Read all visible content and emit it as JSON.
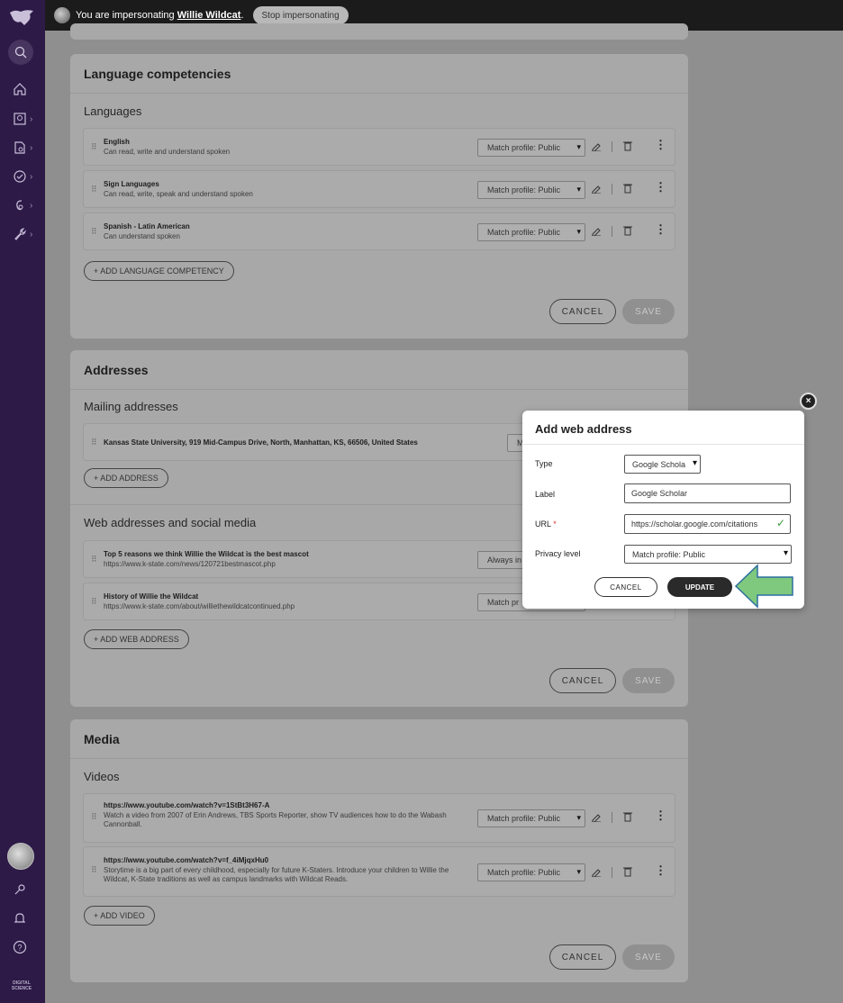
{
  "topbar": {
    "impersonating_prefix": "You are impersonating ",
    "impersonated_user": "Willie Wildcat",
    "impersonating_suffix": ".",
    "stop_button": "Stop impersonating"
  },
  "sidebar": {
    "brand": "DIGITAL SCIENCE",
    "items": [
      {
        "icon": "home-icon"
      },
      {
        "icon": "profile-search-icon"
      },
      {
        "icon": "document-search-icon"
      },
      {
        "icon": "check-circle-icon"
      },
      {
        "icon": "accessibility-icon"
      },
      {
        "icon": "wrench-icon"
      }
    ],
    "bottom_icons": [
      "key-icon",
      "bell-icon",
      "help-icon"
    ]
  },
  "language_card": {
    "title": "Language competencies",
    "subhead": "Languages",
    "rows": [
      {
        "title": "English",
        "sub": "Can read, write and understand spoken",
        "select": "Match profile: Public"
      },
      {
        "title": "Sign Languages",
        "sub": "Can read, write, speak and understand spoken",
        "select": "Match profile: Public"
      },
      {
        "title": "Spanish - Latin American",
        "sub": "Can understand spoken",
        "select": "Match profile: Public"
      }
    ],
    "add_label": "+ ADD LANGUAGE COMPETENCY",
    "cancel": "CANCEL",
    "save": "SAVE"
  },
  "address_card": {
    "title": "Addresses",
    "mailing_subhead": "Mailing addresses",
    "mailing_rows": [
      {
        "title": "Kansas State University, 919 Mid-Campus Drive, North, Manhattan, KS, 66506, United States",
        "select": "M"
      }
    ],
    "add_address": "+ ADD ADDRESS",
    "web_subhead": "Web addresses and social media",
    "web_rows": [
      {
        "title": "Top 5 reasons we think Willie the Wildcat is the best mascot",
        "sub": "https://www.k-state.com/news/120721bestmascot.php",
        "select": "Always in"
      },
      {
        "title": "History of Willie the Wildcat",
        "sub": "https://www.k-state.com/about/williethewildcatcontinued.php",
        "select": "Match pr"
      }
    ],
    "add_web": "+ ADD WEB ADDRESS",
    "cancel": "CANCEL",
    "save": "SAVE"
  },
  "media_card": {
    "title": "Media",
    "subhead": "Videos",
    "rows": [
      {
        "title": "https://www.youtube.com/watch?v=1StBt3H67-A",
        "sub": "Watch a video from 2007 of Erin Andrews, TBS Sports Reporter, show TV audiences how to do the Wabash Cannonball.",
        "select": "Match profile: Public"
      },
      {
        "title": "https://www.youtube.com/watch?v=f_4iMjqxHu0",
        "sub": "Storytime is a big part of every childhood, especially for future K-Staters. Introduce your children to Willie the Wildcat, K-State traditions as well as campus landmarks with Wildcat Reads.",
        "select": "Match profile: Public"
      }
    ],
    "add_video": "+ ADD VIDEO",
    "cancel": "CANCEL",
    "save": "SAVE"
  },
  "modal": {
    "title": "Add web address",
    "type_label": "Type",
    "type_value": "Google Schola",
    "label_label": "Label",
    "label_value": "Google Scholar",
    "url_label": "URL",
    "url_required": "*",
    "url_value": "https://scholar.google.com/citations",
    "privacy_label": "Privacy level",
    "privacy_value": "Match profile: Public",
    "cancel": "CANCEL",
    "update": "UPDATE",
    "close": "×"
  },
  "colors": {
    "sidebar": "#2d1a47",
    "topbar": "#1b1b1b",
    "overlay_bg": "#8f8f8f",
    "arrow": "#7ec97e",
    "update_button": "#2a2a2a"
  }
}
